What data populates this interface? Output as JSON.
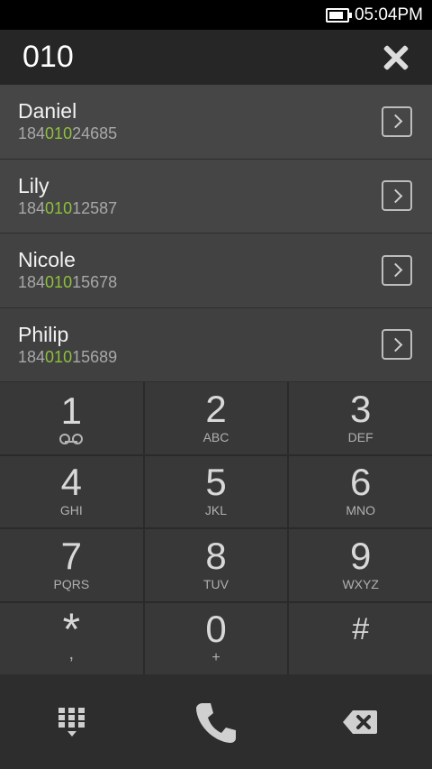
{
  "status_bar": {
    "time": "05:04PM",
    "battery_level": 0.85
  },
  "dialer": {
    "input": "010"
  },
  "results": [
    {
      "name": "Daniel",
      "number_prefix": "184",
      "number_match": "010",
      "number_suffix": "24685"
    },
    {
      "name": "Lily",
      "number_prefix": "184",
      "number_match": "010",
      "number_suffix": "12587"
    },
    {
      "name": "Nicole",
      "number_prefix": "184",
      "number_match": "010",
      "number_suffix": "15678"
    },
    {
      "name": "Philip",
      "number_prefix": "184",
      "number_match": "010",
      "number_suffix": "15689"
    }
  ],
  "keypad": [
    {
      "digit": "1",
      "letters": ""
    },
    {
      "digit": "2",
      "letters": "ABC"
    },
    {
      "digit": "3",
      "letters": "DEF"
    },
    {
      "digit": "4",
      "letters": "GHI"
    },
    {
      "digit": "5",
      "letters": "JKL"
    },
    {
      "digit": "6",
      "letters": "MNO"
    },
    {
      "digit": "7",
      "letters": "PQRS"
    },
    {
      "digit": "8",
      "letters": "TUV"
    },
    {
      "digit": "9",
      "letters": "WXYZ"
    },
    {
      "digit": "*",
      "letters": ","
    },
    {
      "digit": "0",
      "letters": "+"
    },
    {
      "digit": "#",
      "letters": ""
    }
  ],
  "colors": {
    "match": "#8ec03c",
    "background": "#303030"
  },
  "icons": {
    "clear": "close-icon",
    "detail": "chevron-right-icon",
    "dialpad": "dialpad-icon",
    "call": "phone-icon",
    "backspace": "backspace-icon"
  }
}
